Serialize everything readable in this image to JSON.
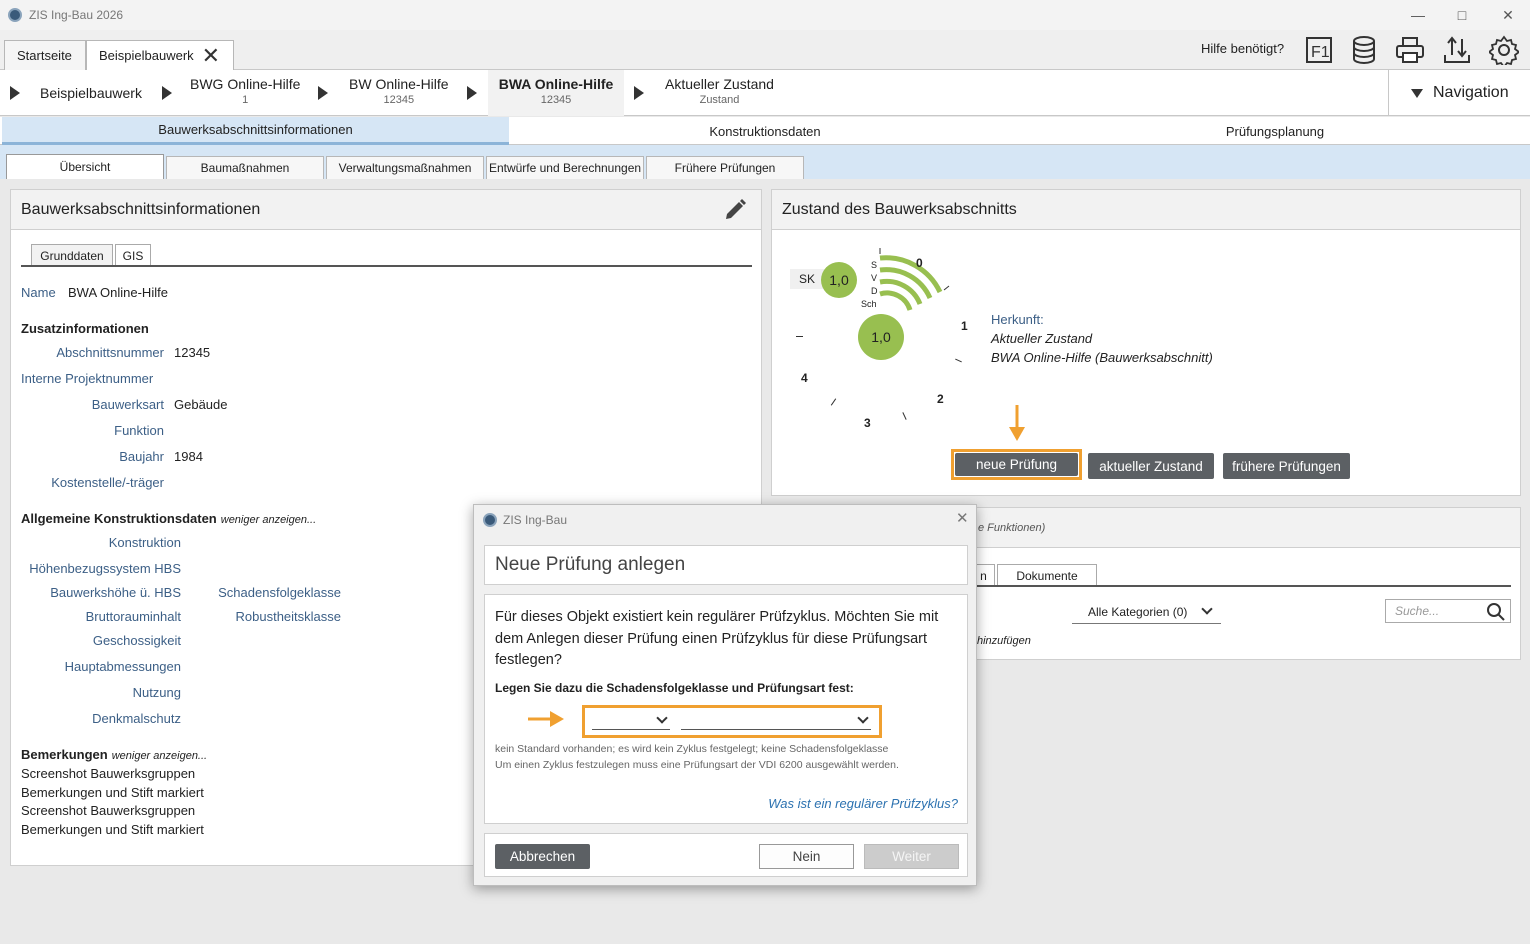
{
  "window": {
    "title": "ZIS Ing-Bau 2026"
  },
  "doc_tabs": [
    {
      "label": "Startseite"
    },
    {
      "label": "Beispielbauwerk"
    }
  ],
  "help": {
    "label": "Hilfe benötigt?"
  },
  "toolbar_icons": [
    "f1-help-icon",
    "database-icon",
    "print-icon",
    "export-icon",
    "settings-icon"
  ],
  "breadcrumb": [
    {
      "label": "Beispielbauwerk",
      "sub": ""
    },
    {
      "label": "BWG Online-Hilfe",
      "sub": "1"
    },
    {
      "label": "BW Online-Hilfe",
      "sub": "12345"
    },
    {
      "label": "BWA Online-Hilfe",
      "sub": "12345"
    },
    {
      "label": "Aktueller Zustand",
      "sub": "Zustand"
    }
  ],
  "navigation": {
    "label": "Navigation"
  },
  "main_tabs": [
    "Bauwerksabschnittsinformationen",
    "Konstruktionsdaten",
    "Prüfungsplanung"
  ],
  "sub_tabs": [
    "Übersicht",
    "Baumaßnahmen",
    "Verwaltungsmaßnahmen",
    "Entwürfe und Berechnungen",
    "Frühere Prüfungen"
  ],
  "info_panel": {
    "title": "Bauwerksabschnittsinformationen",
    "tabs": [
      "Grunddaten",
      "GIS"
    ],
    "name_label": "Name",
    "name_value": "BWA Online-Hilfe",
    "zusatz_title": "Zusatzinformationen",
    "abschnittsnummer_label": "Abschnittsnummer",
    "abschnittsnummer_value": "12345",
    "projektnummer_label": "Interne Projektnummer",
    "bauwerksart_label": "Bauwerksart",
    "bauwerksart_value": "Gebäude",
    "funktion_label": "Funktion",
    "baujahr_label": "Baujahr",
    "baujahr_value": "1984",
    "kostenstelle_label": "Kostenstelle/-träger",
    "konstruktion_title": "Allgemeine Konstruktionsdaten",
    "konstruktion_toggle": "weniger anzeigen...",
    "konstruktion_label": "Konstruktion",
    "hbs_label": "Höhenbezugssystem HBS",
    "bauwerkshoehe_label": "Bauwerkshöhe ü. HBS",
    "schadensfolgeklasse_label": "Schadensfolgeklasse",
    "bruttorauminhalt_label": "Bruttorauminhalt",
    "robustheitsklasse_label": "Robustheitsklasse",
    "geschossigkeit_label": "Geschossigkeit",
    "hauptabmessungen_label": "Hauptabmessungen",
    "nutzung_label": "Nutzung",
    "denkmalschutz_label": "Denkmalschutz",
    "bemerkungen_title": "Bemerkungen",
    "bemerkungen_toggle": "weniger anzeigen...",
    "bemerkungen_lines": [
      "Screenshot Bauwerksgruppen",
      "Bemerkungen und Stift markiert",
      "Screenshot Bauwerksgruppen",
      "Bemerkungen und Stift markiert"
    ]
  },
  "zustand_panel": {
    "title": "Zustand des Bauwerksabschnitts",
    "sk_label": "SK",
    "sk_value": "1,0",
    "main_value": "1,0",
    "svd_labels": [
      "S",
      "V",
      "D",
      "Sch"
    ],
    "gauge_numbers": [
      "0",
      "1",
      "2",
      "3",
      "4"
    ],
    "herkunft_label": "Herkunft:",
    "herkunft_line1": "Aktueller Zustand",
    "herkunft_line2": "BWA Online-Hilfe (Bauwerksabschnitt)",
    "buttons": [
      "neue Prüfung",
      "aktueller Zustand",
      "frühere Prüfungen"
    ],
    "accent_color": "#98bf50",
    "highlight_color": "#f0a030"
  },
  "docs_panel": {
    "header_fragment": "e Funktionen)",
    "tab_fragment": "n",
    "tab_dokumente": "Dokumente",
    "category_select": "Alle Kategorien (0)",
    "search_placeholder": "Suche...",
    "add_fragment": "hinzufügen"
  },
  "dialog": {
    "window_title": "ZIS Ing-Bau",
    "heading": "Neue Prüfung anlegen",
    "question": "Für dieses Objekt existiert kein regulärer Prüfzyklus. Möchten Sie mit dem Anlegen dieser Prüfung einen Prüfzyklus für diese Prüfungsart festlegen?",
    "instruction": "Legen Sie dazu die Schadensfolgeklasse und Prüfungsart fest:",
    "hint_line1": "kein Standard vorhanden; es wird kein Zyklus festgelegt; keine Schadensfolgeklasse",
    "hint_line2": "Um einen Zyklus festzulegen muss eine Prüfungsart der VDI 6200 ausgewählt werden.",
    "help_link": "Was ist ein regulärer Prüfzyklus?",
    "cancel": "Abbrechen",
    "no": "Nein",
    "next": "Weiter"
  }
}
